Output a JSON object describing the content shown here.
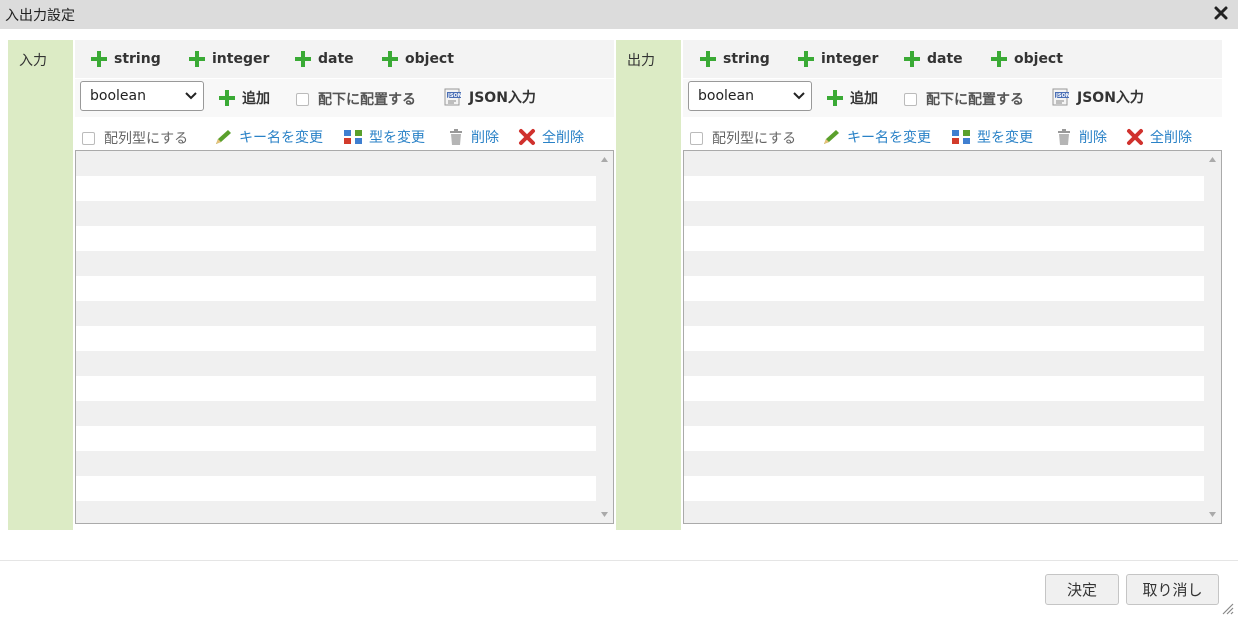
{
  "dialog": {
    "title": "入出力設定"
  },
  "panels": [
    {
      "label": "入力",
      "types": [
        "string",
        "integer",
        "date",
        "object"
      ],
      "select_value": "boolean",
      "add_label": "追加",
      "nest_label": "配下に配置する",
      "json_label": "JSON入力",
      "array_label": "配列型にする",
      "rename_label": "キー名を変更",
      "change_type_label": "型を変更",
      "delete_label": "削除",
      "delete_all_label": "全削除"
    },
    {
      "label": "出力",
      "types": [
        "string",
        "integer",
        "date",
        "object"
      ],
      "select_value": "boolean",
      "add_label": "追加",
      "nest_label": "配下に配置する",
      "json_label": "JSON入力",
      "array_label": "配列型にする",
      "rename_label": "キー名を変更",
      "change_type_label": "型を変更",
      "delete_label": "削除",
      "delete_all_label": "全削除"
    }
  ],
  "footer": {
    "ok_label": "決定",
    "cancel_label": "取り消し"
  },
  "colors": {
    "label_bg": "#dcebc5",
    "link": "#2a82c7",
    "plus": "#3aaa35",
    "delete_x": "#d0312d"
  },
  "icons": {
    "close": "close-icon",
    "add": "plus-icon",
    "json": "json-icon",
    "rename": "pencil-icon",
    "type": "swap-icon",
    "delete": "trash-icon",
    "delete_all": "x-icon"
  }
}
